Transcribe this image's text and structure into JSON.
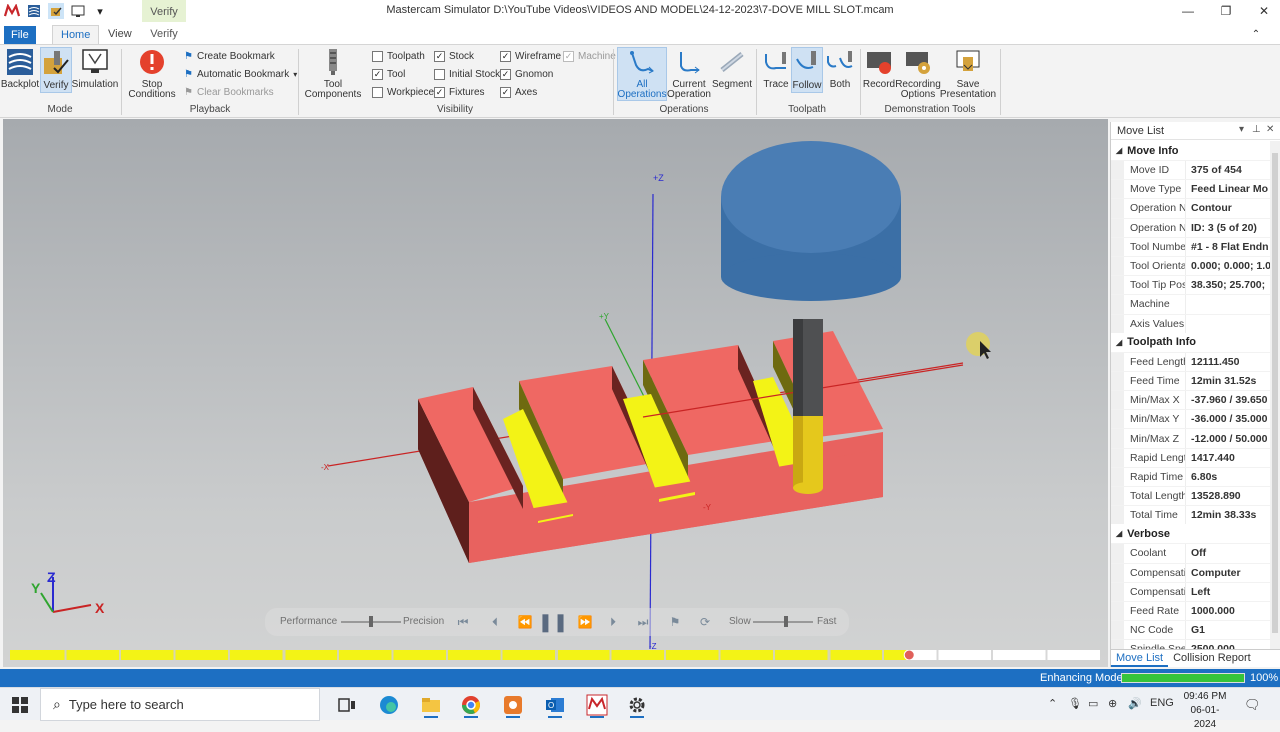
{
  "window": {
    "title": "Mastercam Simulator  D:\\YouTube Videos\\VIDEOS AND MODEL\\24-12-2023\\7-DOVE MILL SLOT.mcam",
    "context_tab": "Verify"
  },
  "tabs": {
    "file": "File",
    "home": "Home",
    "view": "View",
    "verify": "Verify"
  },
  "ribbon": {
    "mode": {
      "label": "Mode",
      "backplot": "Backplot",
      "verify": "Verify",
      "simulation": "Simulation"
    },
    "playback": {
      "label": "Playback",
      "stop_conditions": "Stop\nConditions",
      "create_bookmark": "Create Bookmark",
      "automatic_bookmark": "Automatic Bookmark",
      "clear_bookmarks": "Clear Bookmarks"
    },
    "visibility": {
      "label": "Visibility",
      "tool_components": "Tool\nComponents",
      "toolpath": "Toolpath",
      "tool": "Tool",
      "workpiece": "Workpiece",
      "stock": "Stock",
      "initial_stock": "Initial Stock",
      "fixtures": "Fixtures",
      "wireframe": "Wireframe",
      "gnomon": "Gnomon",
      "axes": "Axes",
      "machine": "Machine",
      "checked": {
        "toolpath": false,
        "tool": true,
        "workpiece": false,
        "stock": true,
        "initial_stock": false,
        "fixtures": true,
        "wireframe": true,
        "gnomon": true,
        "axes": true,
        "machine": true
      }
    },
    "operations": {
      "label": "Operations",
      "all_operations": "All\nOperations",
      "current_operation": "Current\nOperation",
      "segment": "Segment"
    },
    "toolpath": {
      "label": "Toolpath",
      "trace": "Trace",
      "follow": "Follow",
      "both": "Both"
    },
    "demo": {
      "label": "Demonstration Tools",
      "record": "Record",
      "recording_options": "Recording\nOptions",
      "save_presentation": "Save\nPresentation"
    }
  },
  "viewport": {
    "axis_labels": {
      "pos_z": "+Z",
      "pos_y": "+Y",
      "neg_x": "-X",
      "neg_y": "-Y",
      "neg_z": "-Z"
    },
    "gnomon": {
      "x": "X",
      "y": "Y",
      "z": "Z"
    },
    "colors": {
      "stock": "#e8625f",
      "cut": "#f3f316",
      "tool_holder": "#3b6fa6",
      "tool_shank": "#4f5052",
      "tool_cutter": "#e5c81c"
    }
  },
  "playbar": {
    "performance": "Performance",
    "precision": "Precision",
    "slow": "Slow",
    "fast": "Fast",
    "quality_level": 0.5,
    "speed_level": 0.55
  },
  "progress": {
    "fraction": 0.825
  },
  "movelist": {
    "title": "Move List",
    "sections": [
      {
        "name": "Move Info",
        "rows": [
          {
            "k": "Move ID",
            "v": "375 of 454"
          },
          {
            "k": "Move Type",
            "v": "Feed Linear Mo"
          },
          {
            "k": "Operation N",
            "v": "Contour"
          },
          {
            "k": "Operation N",
            "v": "ID: 3 (5 of 20)"
          },
          {
            "k": "Tool Numbe",
            "v": "#1 - 8 Flat Endn"
          },
          {
            "k": "Tool Orienta",
            "v": "0.000; 0.000; 1.0"
          },
          {
            "k": "Tool Tip Pos",
            "v": "38.350; 25.700;"
          },
          {
            "k": "Machine",
            "v": ""
          },
          {
            "k": "Axis Values",
            "v": ""
          }
        ]
      },
      {
        "name": "Toolpath Info",
        "rows": [
          {
            "k": "Feed Length",
            "v": "12111.450"
          },
          {
            "k": "Feed Time",
            "v": "12min 31.52s"
          },
          {
            "k": "Min/Max X",
            "v": "-37.960 / 39.650"
          },
          {
            "k": "Min/Max Y",
            "v": "-36.000 / 35.000"
          },
          {
            "k": "Min/Max Z",
            "v": "-12.000 / 50.000"
          },
          {
            "k": "Rapid Lengt",
            "v": "1417.440"
          },
          {
            "k": "Rapid Time",
            "v": "6.80s"
          },
          {
            "k": "Total Length",
            "v": "13528.890"
          },
          {
            "k": "Total Time",
            "v": "12min 38.33s"
          }
        ]
      },
      {
        "name": "Verbose",
        "rows": [
          {
            "k": "Coolant",
            "v": "Off"
          },
          {
            "k": "Compensati",
            "v": "Computer"
          },
          {
            "k": "Compensati",
            "v": "Left"
          },
          {
            "k": "Feed Rate",
            "v": "1000.000"
          },
          {
            "k": "NC Code",
            "v": "G1"
          },
          {
            "k": "Spindle Spe",
            "v": "2500.000"
          }
        ]
      }
    ],
    "tabs": [
      "Move List",
      "Collision Report"
    ]
  },
  "status": {
    "label": "Enhancing Model",
    "percent": "100%",
    "fraction": 1.0
  },
  "taskbar": {
    "search_placeholder": "Type here to search",
    "lang": "ENG",
    "time": "09:46 PM",
    "date": "06-01-2024"
  }
}
